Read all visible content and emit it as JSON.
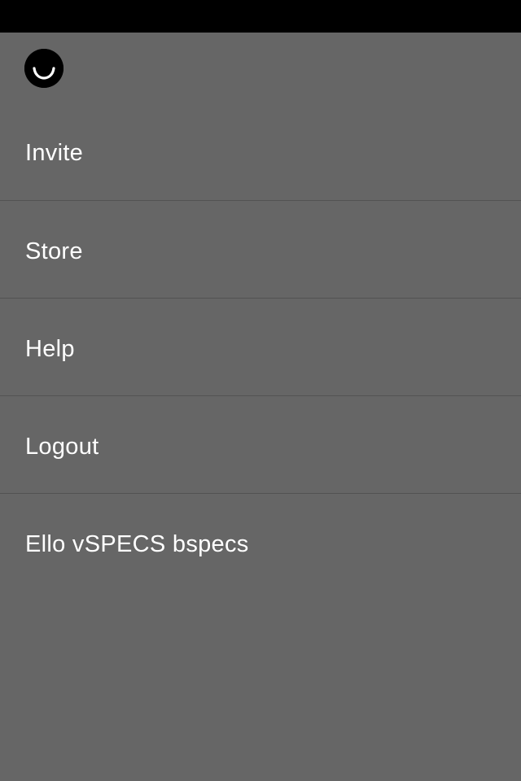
{
  "colors": {
    "status_bar": "#000000",
    "background": "#666666",
    "divider": "#525252",
    "text": "#ffffff",
    "logo_fill": "#000000",
    "logo_mark": "#ffffff"
  },
  "logo": {
    "icon": "ello-smile-icon"
  },
  "menu": {
    "items": [
      {
        "label": "Invite"
      },
      {
        "label": "Store"
      },
      {
        "label": "Help"
      },
      {
        "label": "Logout"
      }
    ],
    "version": "Ello vSPECS bspecs"
  }
}
